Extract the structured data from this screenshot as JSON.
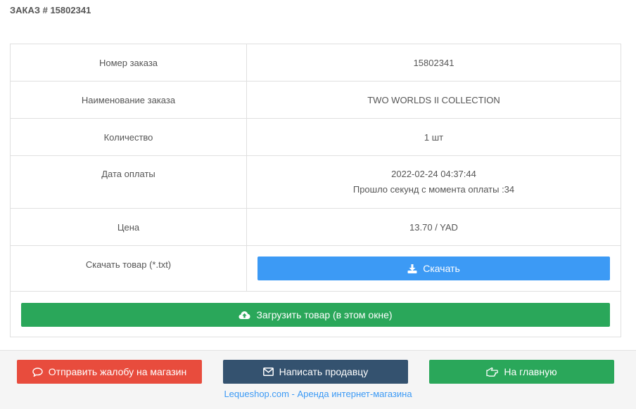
{
  "page": {
    "title": "ЗАКАЗ # 15802341"
  },
  "order": {
    "rows": [
      {
        "label": "Номер заказа",
        "value": "15802341"
      },
      {
        "label": "Наименование заказа",
        "value": "TWO WORLDS II COLLECTION"
      },
      {
        "label": "Количество",
        "value": "1 шт"
      },
      {
        "label": "Дата оплаты",
        "value": "2022-02-24 04:37:44",
        "subvalue": "Прошло секунд с момента оплаты :34"
      },
      {
        "label": "Цена",
        "value": "13.70 / YAD"
      },
      {
        "label": "Скачать товар (*.txt)"
      }
    ],
    "download_label": "Скачать",
    "upload_label": "Загрузить товар (в этом окне)"
  },
  "footer": {
    "complaint_label": "Отправить жалобу на магазин",
    "message_label": "Написать продавцу",
    "home_label": "На главную",
    "link_text": "Lequeshop.com - Аренда интернет-магазина"
  },
  "colors": {
    "primary_blue": "#3c9af5",
    "success_green": "#2aa75a",
    "danger_red": "#e84c3d",
    "navy": "#34526f"
  },
  "icons": {
    "download": "download-icon",
    "upload": "cloud-upload-icon",
    "complaint": "comment-icon",
    "message": "envelope-icon",
    "home": "hand-pointer-left-icon"
  }
}
